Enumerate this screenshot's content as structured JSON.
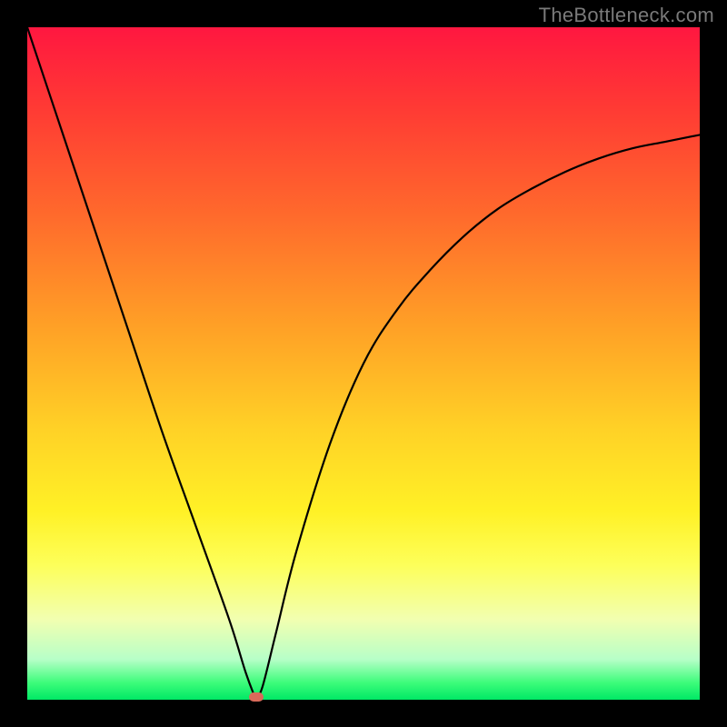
{
  "watermark": "TheBottleneck.com",
  "chart_data": {
    "type": "line",
    "x": [
      0.0,
      0.05,
      0.1,
      0.15,
      0.2,
      0.25,
      0.3,
      0.325,
      0.34,
      0.35,
      0.37,
      0.4,
      0.45,
      0.5,
      0.55,
      0.6,
      0.65,
      0.7,
      0.75,
      0.8,
      0.85,
      0.9,
      0.95,
      1.0
    ],
    "values": [
      100,
      85,
      70,
      55,
      40,
      26,
      12,
      4,
      0,
      2,
      10,
      22,
      38,
      50,
      58,
      64,
      69,
      73,
      76,
      78.5,
      80.5,
      82,
      83,
      84
    ],
    "title": "",
    "xlabel": "",
    "ylabel": "",
    "ylim": [
      0,
      100
    ],
    "xlim": [
      0,
      1
    ],
    "minimum_marker": {
      "x": 0.34,
      "y": 0,
      "color": "#d96a5a"
    },
    "series": [
      {
        "name": "bottleneck-curve",
        "color": "#000000"
      }
    ]
  }
}
